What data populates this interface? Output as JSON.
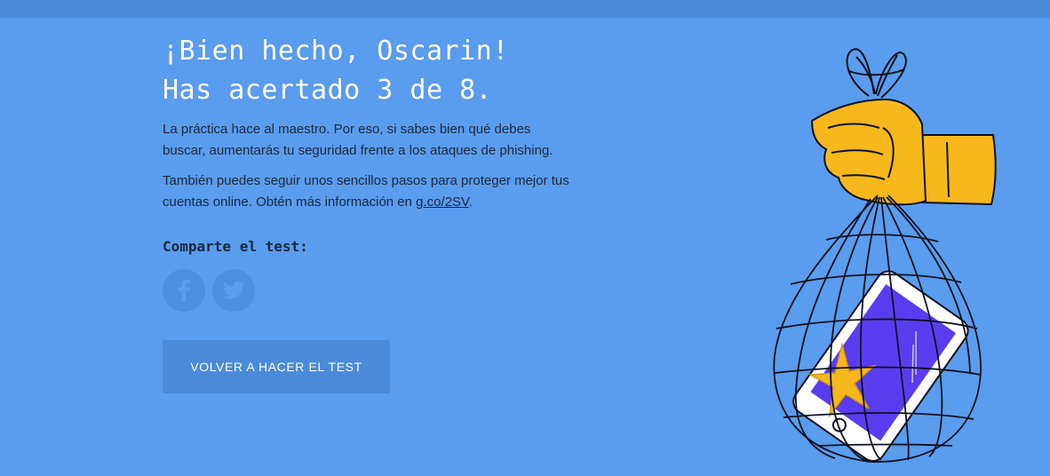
{
  "result": {
    "line1": "¡Bien hecho, Oscarin!",
    "line2": "Has acertado 3 de 8."
  },
  "body": {
    "para1": "La práctica hace al maestro. Por eso, si sabes bien qué debes buscar, aumentarás tu seguridad frente a los ataques de phishing.",
    "para2_prefix": "También puedes seguir unos sencillos pasos para proteger mejor tus cuentas online. Obtén más información en ",
    "link_text": "g.co/2SV",
    "para2_suffix": "."
  },
  "share": {
    "label": "Comparte el test:",
    "facebook_icon": "facebook-icon",
    "twitter_icon": "twitter-icon"
  },
  "cta": {
    "label": "VOLVER A HACER EL TEST"
  },
  "colors": {
    "background": "#5a9ced",
    "top_bar": "#4a8ad9",
    "button": "#4a8ad9",
    "hand": "#f6b81a",
    "phone_screen": "#5a3cf0"
  }
}
